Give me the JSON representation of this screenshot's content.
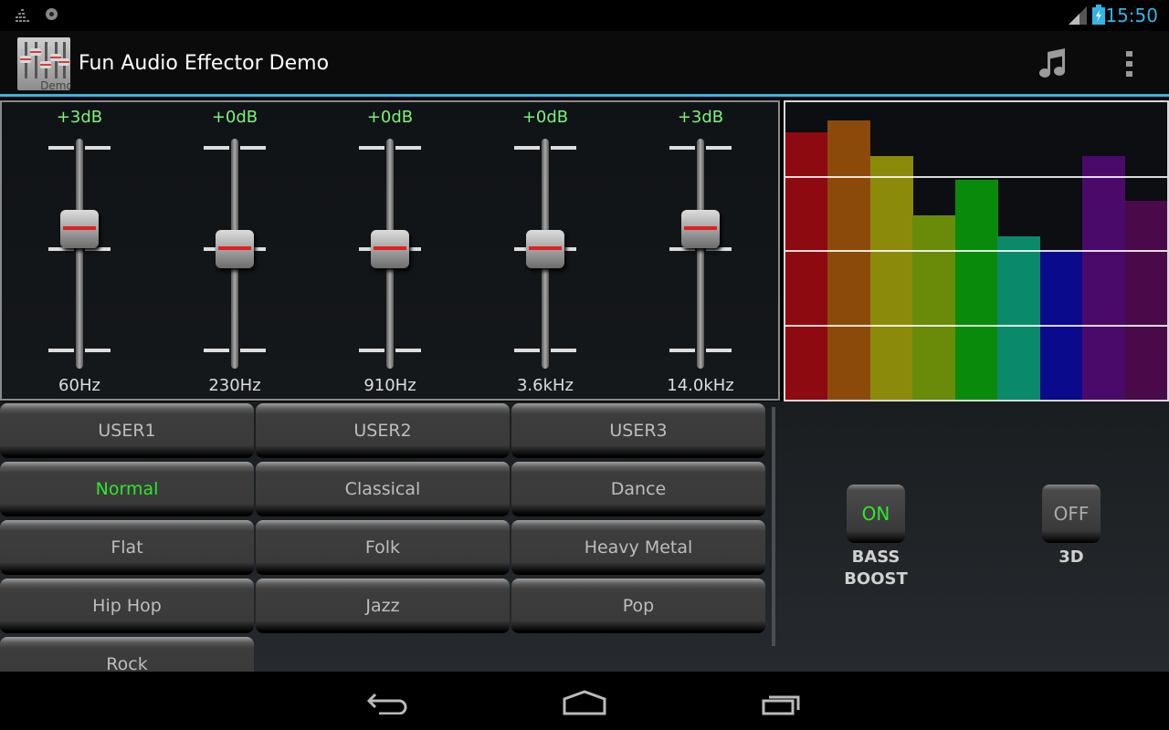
{
  "status_bar": {
    "time": "15:50",
    "icons": [
      "equalizer-notification-icon",
      "disc-notification-icon",
      "signal-icon",
      "battery-charging-icon"
    ]
  },
  "action_bar": {
    "title": "Fun Audio Effector Demo",
    "app_icon_badge": "Demo",
    "actions": [
      "music-note-icon",
      "overflow-menu-icon"
    ]
  },
  "equalizer": {
    "range_db": [
      -15,
      15
    ],
    "bands": [
      {
        "freq": "60Hz",
        "gain_label": "+3dB",
        "gain_db": 3
      },
      {
        "freq": "230Hz",
        "gain_label": "+0dB",
        "gain_db": 0
      },
      {
        "freq": "910Hz",
        "gain_label": "+0dB",
        "gain_db": 0
      },
      {
        "freq": "3.6kHz",
        "gain_label": "+0dB",
        "gain_db": 0
      },
      {
        "freq": "14.0kHz",
        "gain_label": "+3dB",
        "gain_db": 3
      }
    ]
  },
  "visualizer": {
    "gridlines_fraction": [
      0.75,
      0.5,
      0.25
    ],
    "bars": [
      {
        "level": 0.9,
        "color": "#8c0a10"
      },
      {
        "level": 0.94,
        "color": "#8c4a0a"
      },
      {
        "level": 0.82,
        "color": "#8c8a0a"
      },
      {
        "level": 0.62,
        "color": "#6a8a0a"
      },
      {
        "level": 0.74,
        "color": "#0a8a0a"
      },
      {
        "level": 0.55,
        "color": "#0a8a6a"
      },
      {
        "level": 0.5,
        "color": "#0a0a8c"
      },
      {
        "level": 0.82,
        "color": "#4a0a6a"
      },
      {
        "level": 0.67,
        "color": "#4a0a4a"
      }
    ]
  },
  "presets": {
    "selected": "Normal",
    "items": [
      "USER1",
      "USER2",
      "USER3",
      "Normal",
      "Classical",
      "Dance",
      "Flat",
      "Folk",
      "Heavy Metal",
      "Hip Hop",
      "Jazz",
      "Pop",
      "Rock"
    ]
  },
  "effects": {
    "bass_boost": {
      "state": "ON",
      "label_line1": "BASS",
      "label_line2": "BOOST"
    },
    "three_d": {
      "state": "OFF",
      "label": "3D"
    }
  },
  "colors": {
    "accent": "#33b5e5",
    "active_text": "#2fe62f",
    "db_text": "#7cf27c"
  }
}
